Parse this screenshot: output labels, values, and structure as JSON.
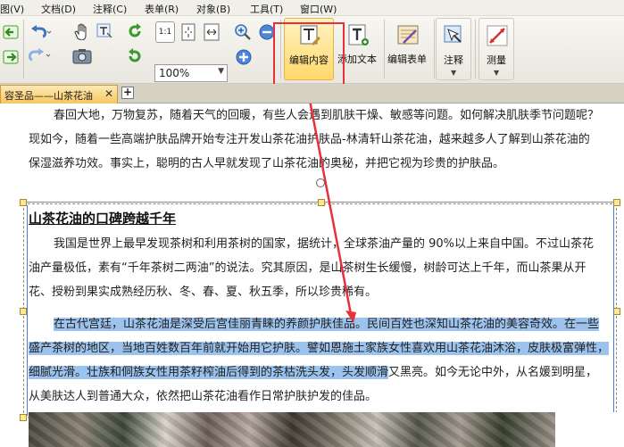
{
  "menu": {
    "items": [
      "图(V)",
      "文档(D)",
      "注释(C)",
      "表单(R)",
      "对象(B)",
      "工具(T)",
      "窗口(W)"
    ]
  },
  "toolbar": {
    "zoom_value": "100%",
    "edit_content_label": "编辑内容",
    "add_text_label": "添加文本",
    "edit_form_label": "编辑表单",
    "annotate_label": "注释",
    "measure_label": "测量",
    "actual_size_label": "1:1"
  },
  "tabs": {
    "doc_tab_label": "容圣品——山茶花油",
    "close_glyph": "✕",
    "add_glyph": "+"
  },
  "document": {
    "para1_lines": [
      "春回大地，万物复苏，随着天气的回暖，有些人会遇到肌肤干燥、敏感等问题。如何解决肌肤季节问题呢？",
      "现如今，随着一些高端护肤品牌开始专注开发山茶花油护肤品-林清轩山茶花油，越来越多人了解到山茶花油的",
      "保湿滋养功效。事实上，聪明的古人早就发现了山茶花油的奥秘，并把它视为珍贵的护肤品。"
    ],
    "heading": "山茶花油的口碑跨越千年",
    "para2_lines": [
      "我国是世界上最早发现茶树和利用茶树的国家，据统计，全球茶油产量的 90%以上来自中国。不过山茶花",
      "油产量极低，素有“千年茶树二两油”的说法。究其原因，是山茶树生长缓慢，树龄可达上千年，而山茶果从开",
      "花、授粉到果实成熟经历秋、冬、春、夏、秋五季，所以珍贵稀有。"
    ],
    "para3_selected_lines": [
      "在古代宫廷，山茶花油是深受后宫佳丽青睐的养颜护肤佳品。民间百姓也深知山茶花油的美容奇效。在一些",
      "盛产茶树的地区，当地百姓数百年前就开始用它护肤。譬如恩施土家族女性喜欢用山茶花油沐浴，皮肤极富弹性，",
      "细腻光滑。壮族和侗族女性用茶籽榨油后得到的茶枯洗头发，头发顺滑"
    ],
    "para3_unselected_tail": "又黑亮。如今无论中外，从名媛到明星，",
    "para3_last_line": "从美肤达人到普通大众，依然把山茶花油看作日常护肤护发的佳品。"
  },
  "colors": {
    "selection": "#9cc3ee",
    "highlight_box": "#e8303a",
    "annotation_arrow": "#e8303a",
    "active_tab": "#f7c75e"
  }
}
